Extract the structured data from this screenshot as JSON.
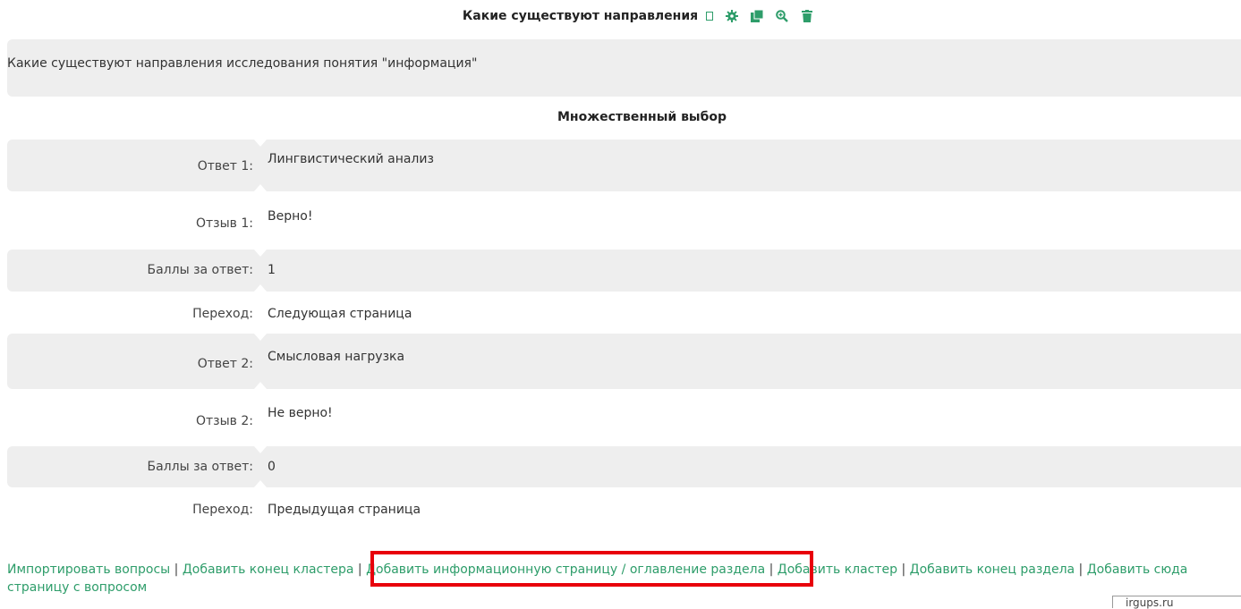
{
  "header": {
    "title": "Какие существуют направления",
    "icons": [
      "bookmark-icon",
      "gear-icon",
      "copy-icon",
      "zoom-in-icon",
      "trash-icon"
    ],
    "accent_color": "#2e9d6a"
  },
  "question": {
    "text": "Какие существуют направления исследования понятия \"информация\"",
    "type": "Множественный выбор"
  },
  "answers": [
    {
      "answer_label": "Ответ 1:",
      "answer": "Лингвистический анализ",
      "feedback_label": "Отзыв 1:",
      "feedback": "Верно!",
      "score_label": "Баллы за ответ:",
      "score": "1",
      "jump_label": "Переход:",
      "jump": "Следующая страница"
    },
    {
      "answer_label": "Ответ 2:",
      "answer": "Смысловая нагрузка",
      "feedback_label": "Отзыв 2:",
      "feedback": "Не верно!",
      "score_label": "Баллы за ответ:",
      "score": "0",
      "jump_label": "Переход:",
      "jump": "Предыдущая страница"
    }
  ],
  "footer": {
    "links": [
      "Импортировать вопросы",
      "Добавить конец кластера",
      "Добавить информационную страницу / оглавление раздела",
      "Добавить кластер",
      "Добавить конец раздела",
      "Добавить сюда страницу с вопросом"
    ],
    "separator": " | "
  },
  "watermark": "irgups.ru"
}
